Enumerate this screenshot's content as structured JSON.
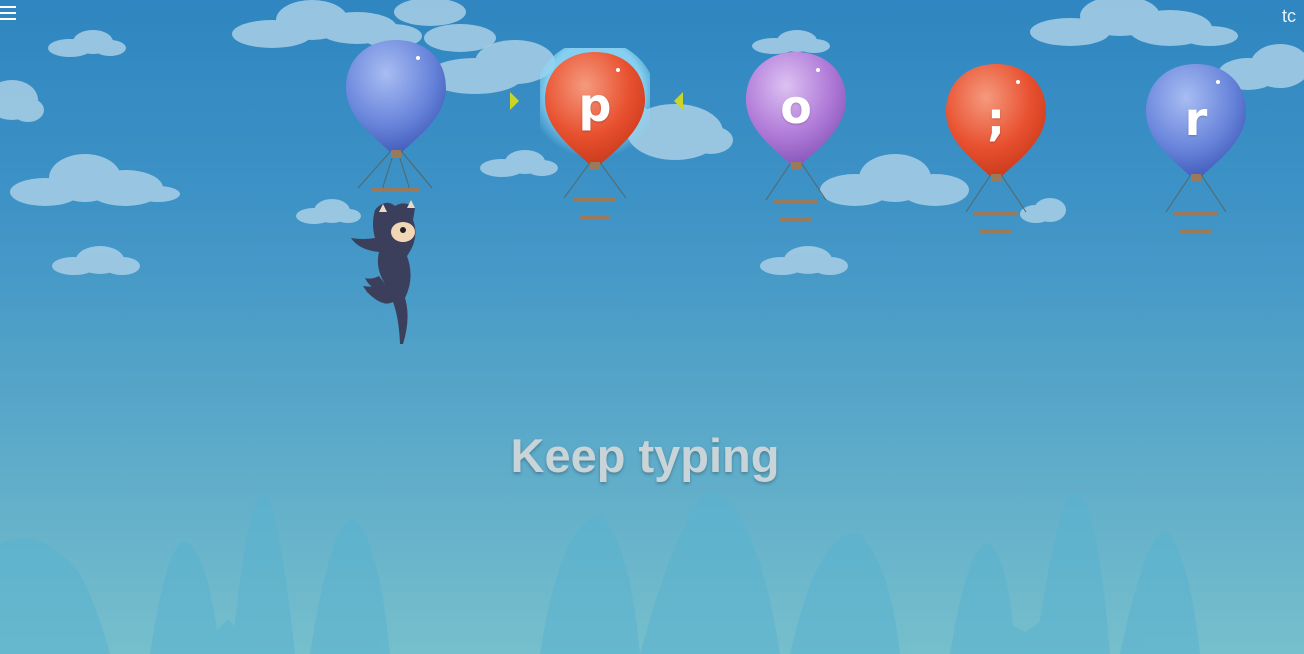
{
  "header": {
    "menu_icon": "hamburger-menu-icon",
    "user_initials": "tc"
  },
  "balloons": [
    {
      "letter": "",
      "color": "blue"
    },
    {
      "letter": "p",
      "color": "red",
      "active": true
    },
    {
      "letter": "o",
      "color": "purple"
    },
    {
      "letter": ";",
      "color": "red"
    },
    {
      "letter": "r",
      "color": "blue"
    }
  ],
  "status": {
    "message": "Keep typing"
  },
  "colors": {
    "sky_top": "#2f86c0",
    "sky_bottom": "#76bfcc",
    "balloon_blue": "#5b7ad6",
    "balloon_red": "#e8502f",
    "balloon_purple": "#b07ad8",
    "marker": "#c9d626"
  }
}
